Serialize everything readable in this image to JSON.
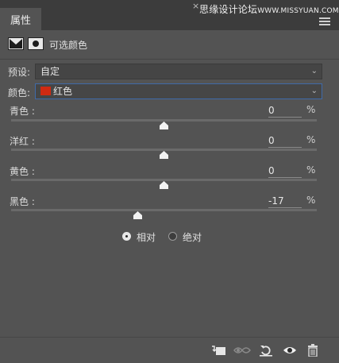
{
  "panel": {
    "tab_label": "属性",
    "close_glyph": "×",
    "watermark_main": "思缘设计论坛",
    "watermark_site": "WWW.MISSYUAN.COM"
  },
  "header": {
    "title": "可选颜色",
    "icons": [
      "selective-color-adjustment-icon",
      "layer-mask-icon"
    ]
  },
  "controls": {
    "preset_label": "预设:",
    "preset_value": "自定",
    "colors_label": "颜色:",
    "colors_value": "红色",
    "colors_swatch": "#d02a12"
  },
  "sliders": [
    {
      "label": "青色 :",
      "value": "0",
      "unit": "%",
      "level": 0
    },
    {
      "label": "洋红 :",
      "value": "0",
      "unit": "%",
      "level": 0
    },
    {
      "label": "黄色 :",
      "value": "0",
      "unit": "%",
      "level": 0
    },
    {
      "label": "黑色 :",
      "value": "-17",
      "unit": "%",
      "level": -17
    }
  ],
  "method": {
    "relative_label": "相对",
    "absolute_label": "绝对",
    "selected": "relative"
  },
  "footer_icons": [
    "clip-to-layer-icon",
    "view-previous-state-icon",
    "reset-icon",
    "visibility-eye-icon",
    "trash-icon"
  ]
}
